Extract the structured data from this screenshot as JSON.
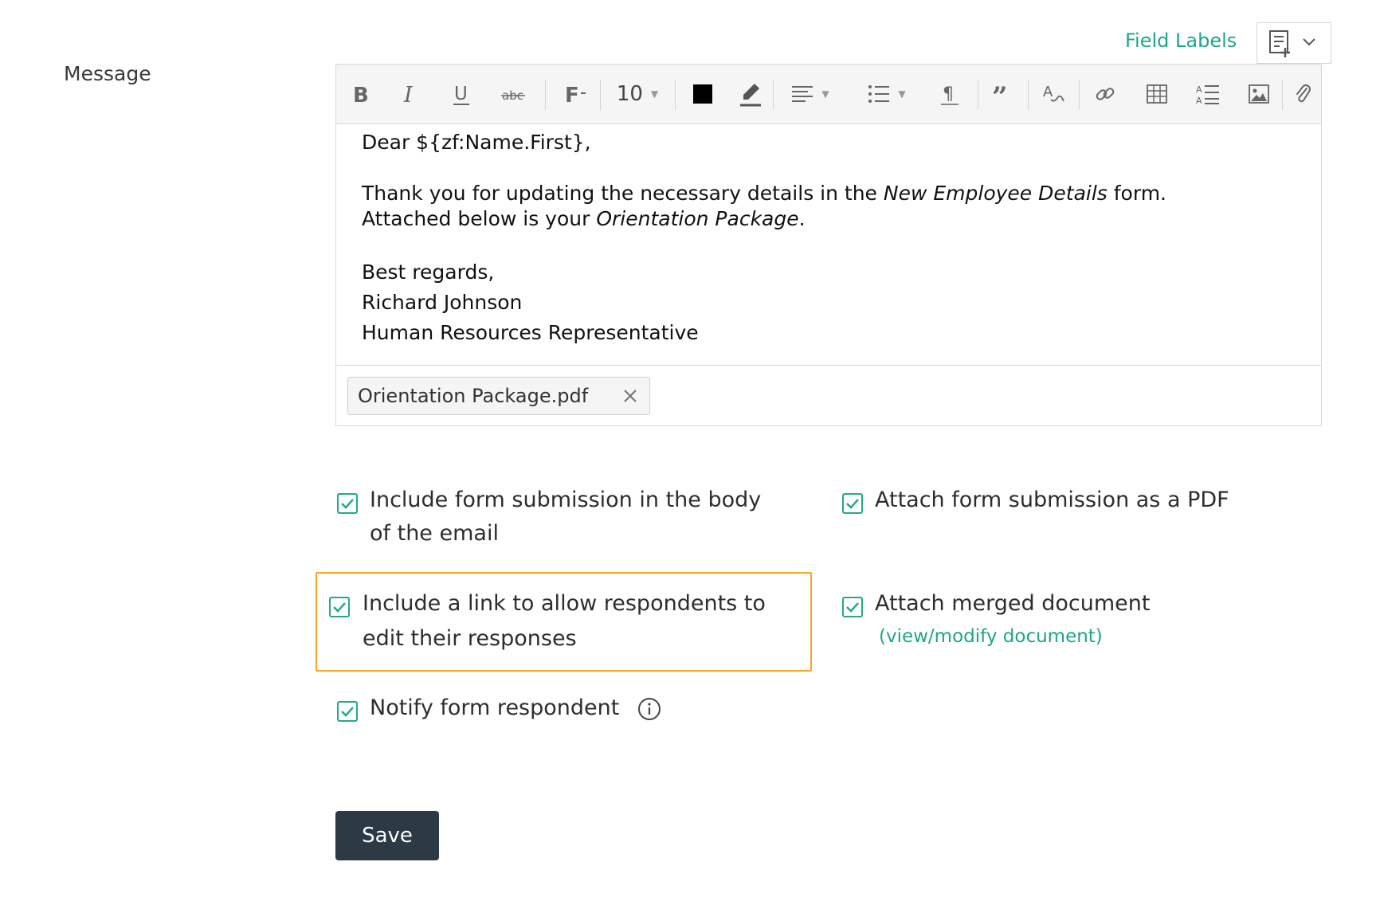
{
  "field": {
    "label": "Message"
  },
  "field_labels": {
    "link": "Field Labels",
    "button_icon": "insert-field-icon"
  },
  "toolbar": {
    "font_size": "10",
    "text_color": "#000000",
    "buttons": [
      "bold-icon",
      "italic-icon",
      "underline-icon",
      "strikethrough-icon",
      "font-family-icon",
      "font-size-select",
      "text-color-icon",
      "highlight-color-icon",
      "align-icon",
      "list-icon",
      "paragraph-icon",
      "quote-icon",
      "spellcheck-icon",
      "link-icon",
      "table-icon",
      "line-spacing-icon",
      "image-icon",
      "attachment-icon"
    ]
  },
  "message": {
    "greeting": "Dear ${zf:Name.First},",
    "line1_pre": "Thank you for updating the necessary details in the ",
    "line1_em": "New Employee Details",
    "line1_post": " form.",
    "line2_pre": "Attached below is your ",
    "line2_em": "Orientation Package",
    "line2_post": ".",
    "closing": "Best regards,",
    "name": "Richard Johnson",
    "title": "Human Resources Representative"
  },
  "attachment": {
    "filename": "Orientation Package.pdf"
  },
  "options": {
    "include_submission_line1": "Include form submission in the body",
    "include_submission_line2": "of the email",
    "attach_pdf": "Attach form submission as a PDF",
    "edit_link_line1": "Include a link to allow respondents to",
    "edit_link_line2": "edit their responses",
    "attach_merged": "Attach merged document",
    "view_modify": "(view/modify document)",
    "notify_respondent": "Notify form respondent"
  },
  "colors": {
    "accent": "#1fa58a",
    "highlight": "#f5a623",
    "save_button": "#2b3a45"
  },
  "save": {
    "label": "Save"
  }
}
